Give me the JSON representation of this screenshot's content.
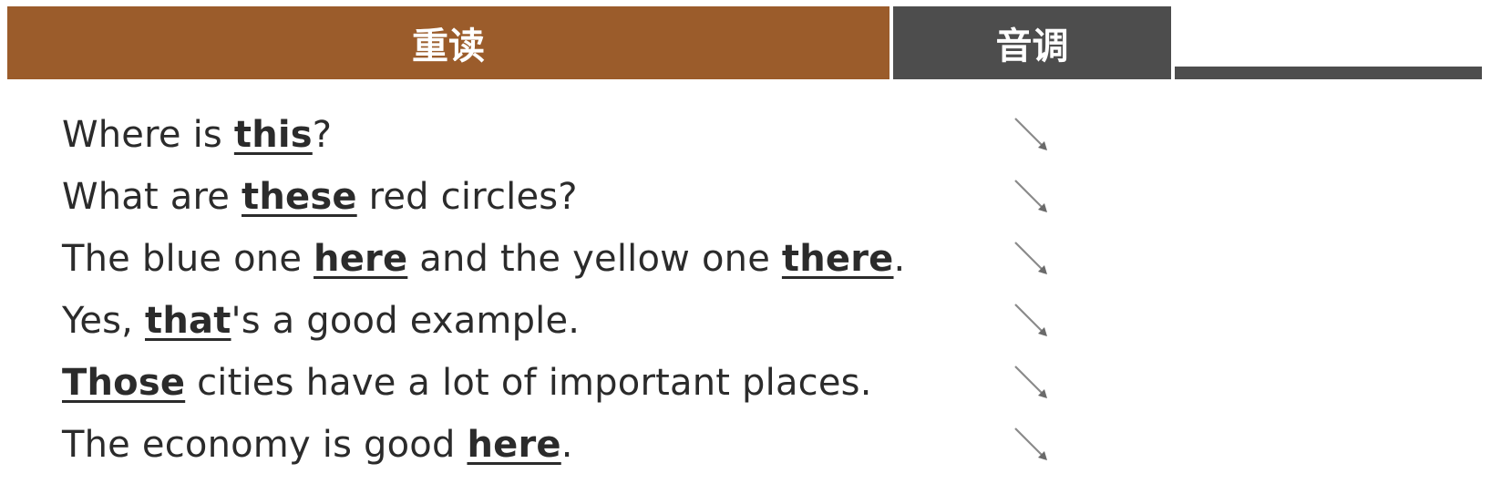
{
  "header": {
    "stress_label": "重读",
    "tone_label": "音调"
  },
  "rows": [
    {
      "segments": [
        {
          "text": "Where is ",
          "stress": false
        },
        {
          "text": "this",
          "stress": true
        },
        {
          "text": "?",
          "stress": false
        }
      ],
      "tone_icon": "falling-arrow-icon"
    },
    {
      "segments": [
        {
          "text": "What are ",
          "stress": false
        },
        {
          "text": "these",
          "stress": true
        },
        {
          "text": " red circles?",
          "stress": false
        }
      ],
      "tone_icon": "falling-arrow-icon"
    },
    {
      "segments": [
        {
          "text": "The blue one ",
          "stress": false
        },
        {
          "text": "here",
          "stress": true
        },
        {
          "text": " and the yellow one ",
          "stress": false
        },
        {
          "text": "there",
          "stress": true
        },
        {
          "text": ".",
          "stress": false
        }
      ],
      "tone_icon": "falling-arrow-icon"
    },
    {
      "segments": [
        {
          "text": "Yes, ",
          "stress": false
        },
        {
          "text": "that",
          "stress": true
        },
        {
          "text": "'s a good example.",
          "stress": false
        }
      ],
      "tone_icon": "falling-arrow-icon"
    },
    {
      "segments": [
        {
          "text": "Those",
          "stress": true
        },
        {
          "text": " cities have a lot of important places.",
          "stress": false
        }
      ],
      "tone_icon": "falling-arrow-icon"
    },
    {
      "segments": [
        {
          "text": "The economy is good ",
          "stress": false
        },
        {
          "text": "here",
          "stress": true
        },
        {
          "text": ".",
          "stress": false
        }
      ],
      "tone_icon": "falling-arrow-icon"
    }
  ],
  "colors": {
    "stress_header": "#9b5c2b",
    "tone_header": "#4d4d4d",
    "text": "#2b2b2b"
  }
}
